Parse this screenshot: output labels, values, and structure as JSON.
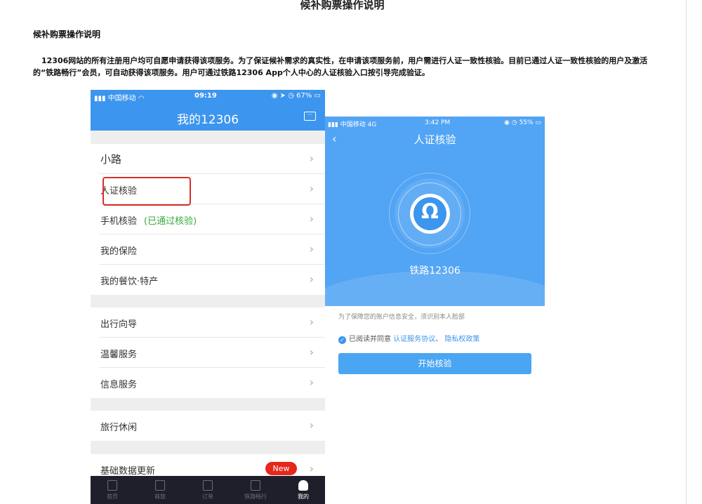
{
  "page": {
    "title": "候补购票操作说明",
    "section_heading": "候补购票操作说明",
    "intro": "12306网站的所有注册用户均可自愿申请获得该项服务。为了保证候补需求的真实性，在申请该项服务前，用户需进行人证一致性核验。目前已通过人证一致性核验的用户及激活的“铁路畅行”会员，可自动获得该项服务。用户可通过铁路12306 App个人中心的人证核验入口按引导完成验证。"
  },
  "phone1": {
    "status": {
      "carrier": "中国移动",
      "time": "09:19",
      "battery": "67%"
    },
    "title": "我的12306",
    "groups": [
      {
        "items": [
          {
            "label": "小路",
            "big": true
          },
          {
            "label": "人证核验",
            "highlighted": true
          },
          {
            "label": "手机核验",
            "note": "(已通过核验)"
          },
          {
            "label": "我的保险"
          },
          {
            "label": "我的餐饮·特产"
          }
        ]
      },
      {
        "items": [
          {
            "label": "出行向导"
          },
          {
            "label": "温馨服务"
          },
          {
            "label": "信息服务"
          }
        ]
      },
      {
        "items": [
          {
            "label": "旅行休闲"
          }
        ]
      },
      {
        "items": [
          {
            "label": "基础数据更新",
            "badge": "New"
          }
        ]
      }
    ],
    "tabs": [
      {
        "label": "首页",
        "icon": "home-icon"
      },
      {
        "label": "商旅",
        "icon": "briefcase-icon"
      },
      {
        "label": "订单",
        "icon": "order-icon"
      },
      {
        "label": "铁路畅行",
        "icon": "diamond-icon"
      },
      {
        "label": "我的",
        "icon": "person-icon",
        "active": true
      }
    ],
    "chevron": "›"
  },
  "phone2": {
    "status": {
      "carrier": "中国移动",
      "network": "4G",
      "time": "3:42 PM",
      "battery": "55%"
    },
    "back": "‹",
    "title": "人证核验",
    "brand": "铁路12306",
    "note": "为了保障您的账户信息安全，须识别本人脸部",
    "agree_text": "已阅读并同意",
    "agree_link1": "认证服务协议",
    "agree_sep": "、",
    "agree_link2": "隐私权政策",
    "start_button": "开始核验"
  },
  "colors": {
    "primary_blue": "#3c95ee",
    "highlight_red": "#d92e27",
    "badge_red": "#e5271c",
    "verified_green": "#37a93f"
  }
}
